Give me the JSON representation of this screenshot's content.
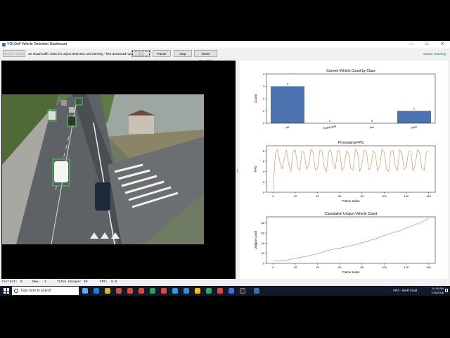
{
  "window": {
    "title": "YOLOv8 Vehicle Detection Dashboard",
    "minimize": "—",
    "maximize": "☐",
    "close": "✕"
  },
  "toolbar": {
    "browse_label": "Browse Video",
    "source_text": "4K Road traffic video for object detection and tracking - free download now.mp4",
    "start_label": "Start",
    "pause_label": "Pause",
    "stop_label": "Stop",
    "reset_label": "Reset Counters",
    "status_text": "Status: Running",
    "status_color": "#0a8a2a"
  },
  "statusbar": {
    "current_label": "Current:",
    "current_value": "5",
    "new_label": "New:",
    "new_value": "1",
    "total_label": "Total Unique:",
    "total_value": "89",
    "fps_label": "FPS:",
    "fps_value": "8.0"
  },
  "taskbar": {
    "search_placeholder": "Type here to search",
    "tray_app": "FRA - MAR Final",
    "time": "10:16 AM",
    "date": "7/10/2026"
  },
  "chart_data": [
    {
      "type": "bar",
      "title": "Current Vehicle Count by Class",
      "xlabel": "",
      "ylabel": "Count",
      "categories": [
        "car",
        "motorcycle",
        "bus",
        "truck"
      ],
      "values": [
        3,
        0,
        0,
        1
      ],
      "ylim": [
        0,
        4
      ],
      "yticks": [
        0,
        1,
        2,
        3,
        4
      ],
      "color": "#4c72b0"
    },
    {
      "type": "line",
      "title": "Processing FPS",
      "xlabel": "Frame Index",
      "ylabel": "FPS",
      "xlim": [
        -6,
        146
      ],
      "ylim": [
        0,
        9
      ],
      "xticks": [
        0,
        20,
        40,
        60,
        80,
        100,
        120,
        140
      ],
      "yticks": [
        0,
        2,
        4,
        6,
        8
      ],
      "color": "#dd8452",
      "x_start": 0,
      "x_step": 2,
      "values": [
        0.5,
        7.5,
        8.3,
        6.0,
        4.5,
        6.5,
        8.1,
        5.5,
        4.0,
        7.9,
        8.2,
        5.0,
        4.2,
        8.0,
        7.6,
        4.5,
        5.2,
        8.3,
        7.8,
        4.3,
        4.6,
        8.0,
        8.1,
        4.8,
        4.0,
        7.8,
        8.2,
        5.6,
        4.5,
        8.1,
        7.9,
        4.2,
        5.0,
        8.0,
        7.4,
        4.6,
        4.3,
        8.3,
        7.7,
        4.0,
        5.5,
        8.2,
        7.9,
        4.4,
        4.8,
        8.0,
        7.5,
        4.2,
        5.1,
        8.3,
        7.8,
        4.5,
        4.0,
        7.9,
        8.1,
        5.0,
        4.3,
        8.2,
        7.6,
        4.4,
        4.9,
        8.0,
        7.9,
        4.1,
        5.3,
        8.2,
        7.7,
        4.6,
        4.2,
        7.8,
        8.0
      ]
    },
    {
      "type": "line",
      "title": "Cumulative Unique Vehicle Count",
      "xlabel": "Frame Index",
      "ylabel": "Unique count",
      "xlim": [
        -6,
        146
      ],
      "ylim": [
        0,
        92
      ],
      "xticks": [
        0,
        20,
        40,
        60,
        80,
        100,
        120,
        140
      ],
      "yticks": [
        0,
        20,
        40,
        60,
        80
      ],
      "color": "#55a868",
      "x": [
        0,
        4,
        8,
        12,
        16,
        20,
        24,
        28,
        32,
        36,
        40,
        44,
        48,
        52,
        56,
        60,
        64,
        68,
        72,
        76,
        80,
        84,
        88,
        92,
        96,
        100,
        104,
        108,
        112,
        116,
        120,
        124,
        128,
        132,
        136,
        140
      ],
      "values": [
        5,
        5,
        5,
        6,
        8,
        10,
        12,
        13,
        15,
        17,
        19,
        22,
        25,
        27,
        29,
        30,
        32,
        34,
        36,
        38,
        41,
        43,
        46,
        48,
        52,
        55,
        58,
        61,
        63,
        66,
        70,
        73,
        77,
        80,
        84,
        89
      ]
    }
  ]
}
